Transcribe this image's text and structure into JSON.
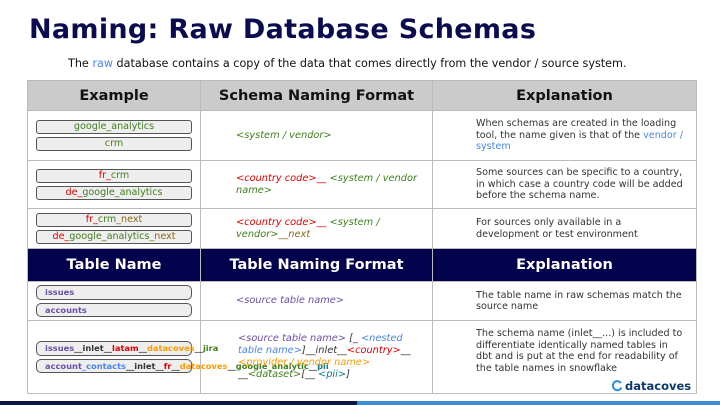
{
  "title": "Naming: Raw Database Schemas",
  "subtitle": {
    "pre": "The ",
    "highlight": "raw",
    "post": " database contains a copy of the data that comes directly from the vendor / source system."
  },
  "schema_headers": [
    "Example",
    "Schema Naming Format",
    "Explanation"
  ],
  "schema_rows": [
    {
      "examples": [
        [
          [
            "g",
            "google_analytics"
          ]
        ],
        [
          [
            "g",
            "crm"
          ]
        ]
      ],
      "format": [
        [
          "g",
          "<system / vendor>"
        ]
      ],
      "explanation": [
        [
          "k",
          "When schemas are created in the loading tool, the name given is that of the "
        ],
        [
          "b",
          "vendor / system"
        ]
      ]
    },
    {
      "examples": [
        [
          [
            "r",
            "fr_"
          ],
          [
            "g",
            "crm"
          ]
        ],
        [
          [
            "r",
            "de_"
          ],
          [
            "g",
            "google_analytics"
          ]
        ]
      ],
      "format": [
        [
          "r",
          "<country code>__"
        ],
        [
          "g",
          " <system / vendor name>"
        ]
      ],
      "explanation": [
        [
          "k",
          "Some sources can be specific to a country, in which case a country code will be added before the schema name."
        ]
      ]
    },
    {
      "examples": [
        [
          [
            "r",
            "fr_"
          ],
          [
            "g",
            "crm"
          ],
          [
            "o",
            "_next"
          ]
        ],
        [
          [
            "r",
            "de_"
          ],
          [
            "g",
            "google_analytics"
          ],
          [
            "o",
            "_next"
          ]
        ]
      ],
      "format": [
        [
          "r",
          "<country code>__"
        ],
        [
          "g",
          " <system / vendor>"
        ],
        [
          "o",
          "__next"
        ]
      ],
      "explanation": [
        [
          "k",
          "For sources only available in a development or test environment"
        ]
      ]
    }
  ],
  "table_headers": [
    "Table Name",
    "Table Naming Format",
    "Explanation"
  ],
  "table_rows": [
    {
      "examples": [
        [
          [
            "p",
            "issues"
          ]
        ],
        [
          [
            "p",
            "accounts"
          ]
        ]
      ],
      "format": [
        [
          "p",
          "<source table name>"
        ]
      ],
      "explanation": [
        [
          "k",
          "The table name in raw schemas match the source name"
        ]
      ]
    },
    {
      "examples": [
        [
          [
            "p",
            "issues"
          ],
          [
            "k",
            "__inlet__"
          ],
          [
            "r",
            "latam"
          ],
          [
            "k",
            "__"
          ],
          [
            "or",
            "datacoves"
          ],
          [
            "k",
            "__"
          ],
          [
            "g",
            "jira"
          ]
        ],
        [
          [
            "p",
            "account"
          ],
          [
            "b",
            "_contacts"
          ],
          [
            "k",
            "__inlet__"
          ],
          [
            "r",
            "fr"
          ],
          [
            "k",
            "__"
          ],
          [
            "or",
            "datacoves"
          ],
          [
            "k",
            "__"
          ],
          [
            "g",
            "google_analytic"
          ],
          [
            "k",
            "__"
          ],
          [
            "tl",
            "pii"
          ]
        ]
      ],
      "format": [
        [
          "p",
          "<source table name>"
        ],
        [
          "k",
          " [_ "
        ],
        [
          "b",
          "<nested table name>"
        ],
        [
          "k",
          "]__inlet__"
        ],
        [
          "r",
          "<country>"
        ],
        [
          "k",
          "__ "
        ],
        [
          "or",
          "<provider / vendor name>"
        ],
        [
          "k",
          " __"
        ],
        [
          "g",
          "<dataset>"
        ],
        [
          "k",
          "[__ "
        ],
        [
          "tl",
          "<pii>"
        ],
        [
          "k",
          "]"
        ]
      ],
      "explanation": [
        [
          "k",
          "The schema name (inlet__...) is included to differentiate identically named tables in dbt and is put at the end for readability of the table names in snowflake"
        ]
      ]
    }
  ],
  "logo": {
    "text": "datacoves",
    "icon": "datacoves-logo-icon"
  },
  "colors": {
    "title": "#0b0b4f",
    "dark_header": "#03034d",
    "gray_header": "#cbcbcb",
    "green": "#3f7f1e",
    "red": "#e00000",
    "olive": "#8b6914",
    "purple": "#6b4fa6",
    "blue": "#4a86e8",
    "orange": "#ff9900",
    "teal": "#0f7a8a"
  }
}
